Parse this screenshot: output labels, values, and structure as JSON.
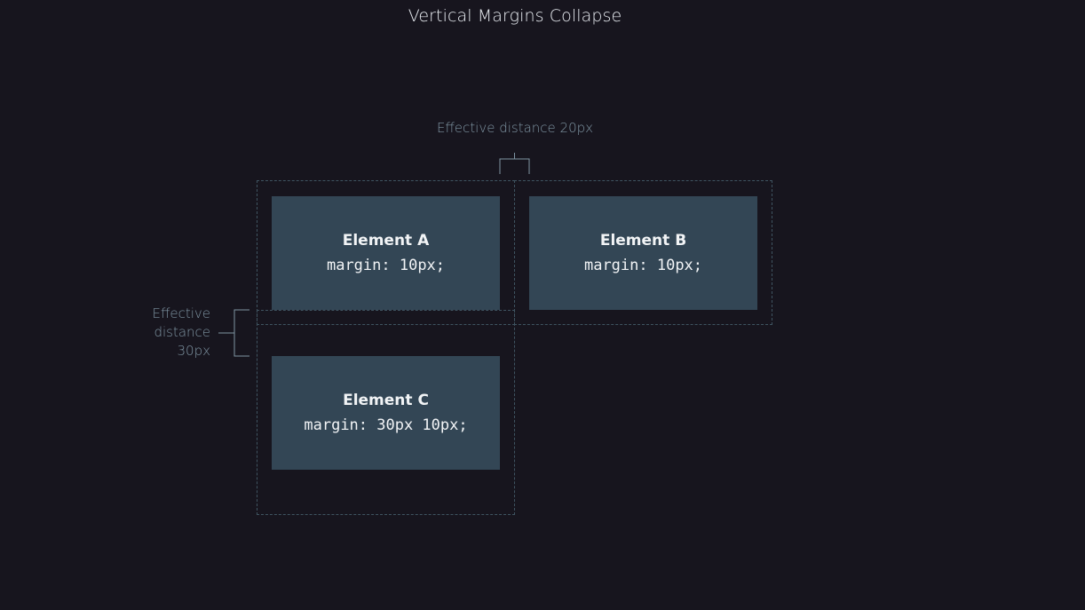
{
  "title": "Vertical Margins Collapse",
  "elements": {
    "a": {
      "name": "Element A",
      "code": "margin: 10px;"
    },
    "b": {
      "name": "Element B",
      "code": "margin: 10px;"
    },
    "c": {
      "name": "Element C",
      "code": "margin: 30px 10px;"
    }
  },
  "annotations": {
    "horizontal": "Effective distance 20px",
    "vertical_lines": [
      "Effective",
      "distance",
      "30px"
    ]
  },
  "colors": {
    "background": "#17151e",
    "element_fill": "#334655",
    "margin_outline": "#3f5461",
    "annotation_text": "#7f95a3"
  }
}
